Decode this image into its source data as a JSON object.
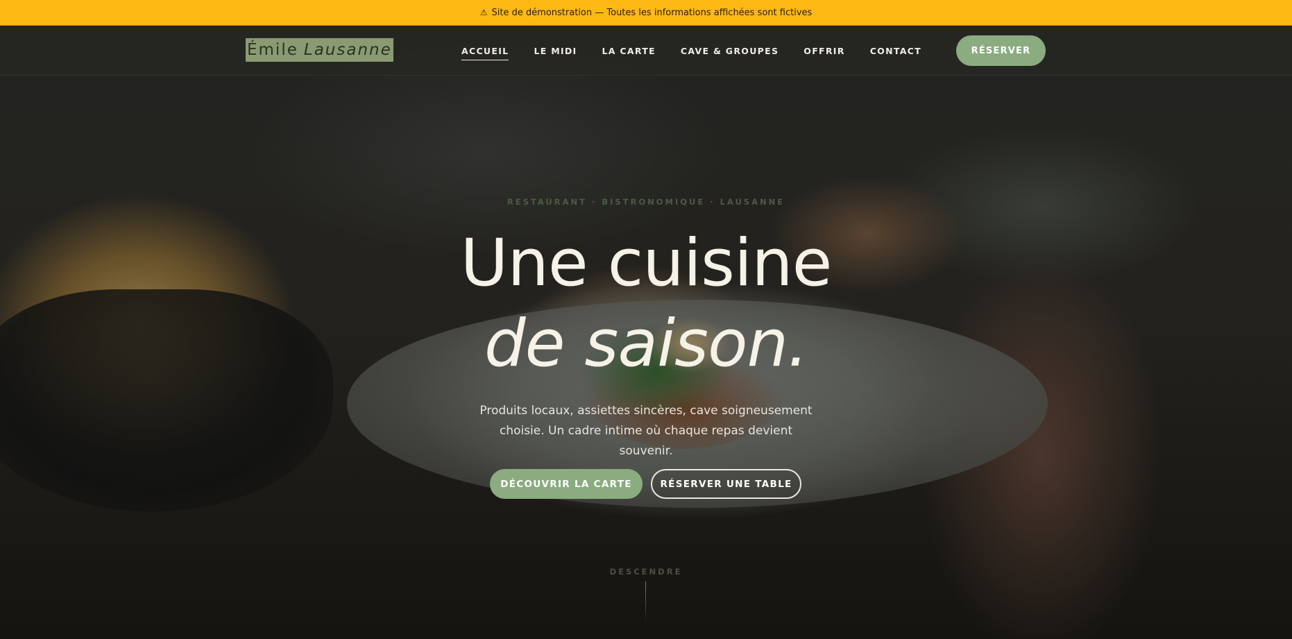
{
  "demo_banner": {
    "icon": "warning-icon",
    "glyph": "⚠",
    "text": "Site de démonstration — Toutes les informations affichées sont fictives"
  },
  "header": {
    "logo": {
      "name": "Émile",
      "city": "Lausanne"
    },
    "nav": [
      {
        "label": "ACCUEIL",
        "active": true
      },
      {
        "label": "LE MIDI",
        "active": false
      },
      {
        "label": "LA CARTE",
        "active": false
      },
      {
        "label": "CAVE & GROUPES",
        "active": false
      },
      {
        "label": "OFFRIR",
        "active": false
      },
      {
        "label": "CONTACT",
        "active": false
      }
    ],
    "reserve_label": "RÉSERVER"
  },
  "hero": {
    "eyebrow": "RESTAURANT · BISTRONOMIQUE · LAUSANNE",
    "headline_line1": "Une cuisine",
    "headline_line2": "de saison.",
    "subtitle": "Produits locaux, assiettes sincères, cave soigneusement choisie. Un cadre intime où chaque repas devient souvenir.",
    "cta_primary": "DÉCOUVRIR LA CARTE",
    "cta_secondary": "RÉSERVER UNE TABLE",
    "scroll_label": "DESCENDRE"
  },
  "colors": {
    "banner": "#fdb913",
    "accent_green": "#8aac80",
    "header_bg": "#262622",
    "text_light": "#f6f2e8"
  }
}
